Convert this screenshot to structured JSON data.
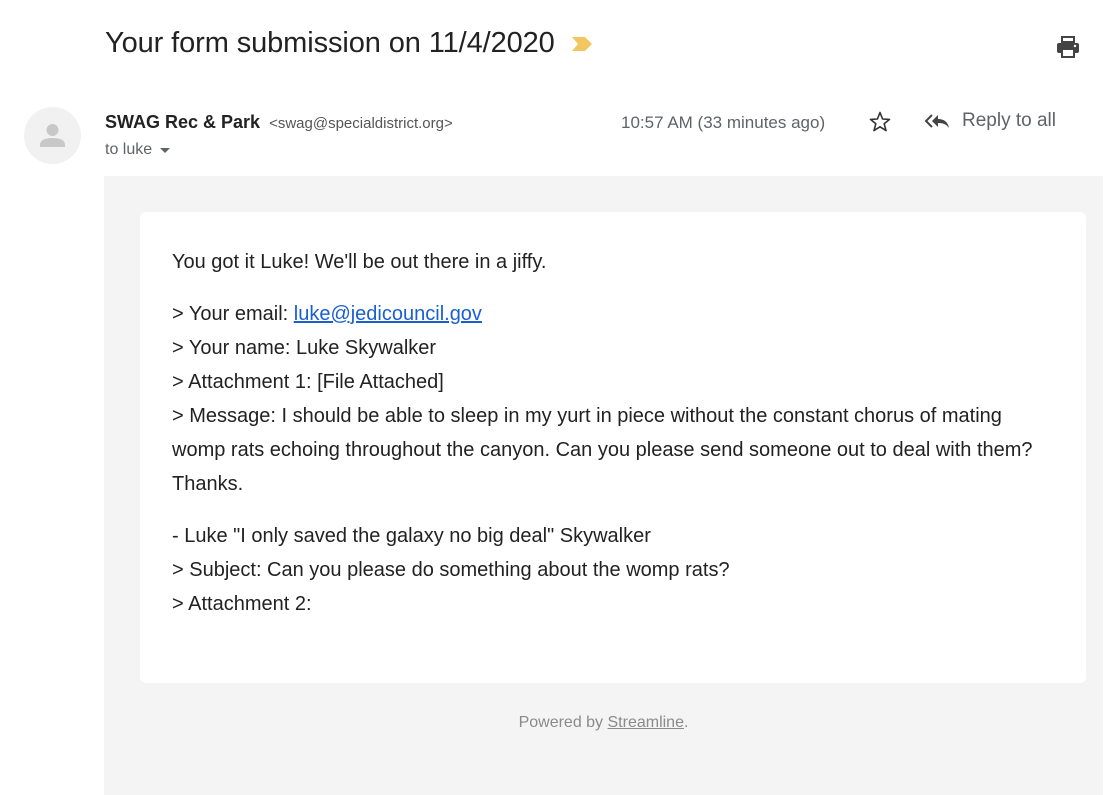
{
  "email": {
    "subject": "Your form submission on 11/4/2020",
    "importance_icon": "importance-marker-icon",
    "importance_color": "#f2c660",
    "print_icon": "printer-icon",
    "sender": {
      "name": "SWAG Rec & Park",
      "email": "<swag@specialdistrict.org>",
      "avatar_icon": "person-icon"
    },
    "recipient_label": "to luke",
    "timestamp": "10:57 AM (33 minutes ago)",
    "star_icon": "star-outline-icon",
    "reply_all_label": "Reply to all"
  },
  "body": {
    "greeting": "You got it Luke! We'll be out there in a jiffy.",
    "fields": {
      "email_label": "> Your email: ",
      "email_value": "luke@jedicouncil.gov",
      "name_line": "> Your name: Luke Skywalker",
      "attachment1_line": "> Attachment 1: [File Attached]",
      "message_line": "> Message: I should be able to sleep in my yurt in piece without the constant chorus of mating womp rats echoing throughout the canyon. Can you please send someone out to deal with them? Thanks."
    },
    "signature_line": "- Luke \"I only saved the galaxy no big deal\" Skywalker",
    "subject_line": "> Subject: Can you please do something about the womp rats?",
    "attachment2_line": "> Attachment 2:",
    "link_color": "#1a5fd1"
  },
  "footer": {
    "prefix": "Powered by ",
    "link_label": "Streamline",
    "suffix": "."
  }
}
